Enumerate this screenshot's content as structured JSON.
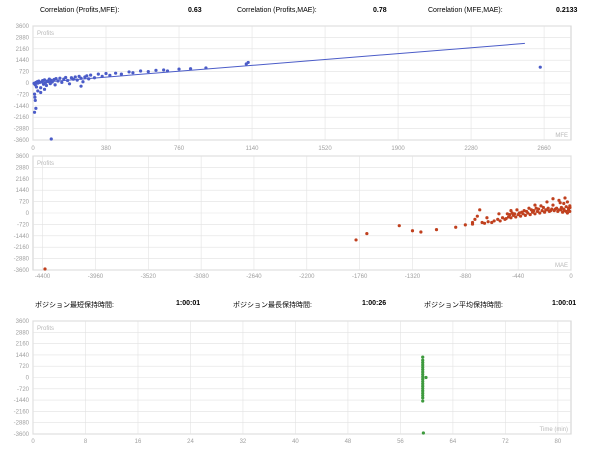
{
  "stats_top": [
    {
      "label": "Correlation (Profits,MFE):",
      "value": "0.63"
    },
    {
      "label": "Correlation (Profits,MAE):",
      "value": "0.78"
    },
    {
      "label": "Correlation (MFE,MAE):",
      "value": "0.2133"
    }
  ],
  "stats_mid": [
    {
      "label": "ポジション最短保持時間:",
      "value": "1:00:01"
    },
    {
      "label": "ポジション最長保持時間:",
      "value": "1:00:26"
    },
    {
      "label": "ポジション平均保持時間:",
      "value": "1:00:01"
    }
  ],
  "colors": {
    "mfe": "#4b5cc8",
    "mae": "#c0401e",
    "time": "#3e9a3e",
    "grid": "#e2e2e2",
    "frame": "#cfcfcf",
    "tick": "#a0a0a0"
  },
  "chart_data": [
    {
      "type": "scatter",
      "xlabel": "MFE",
      "ylabel": "Profits",
      "xticks": [
        "0",
        "380",
        "760",
        "1140",
        "1520",
        "1900",
        "2280",
        "2660"
      ],
      "yticks": [
        "3600",
        "2880",
        "2160",
        "1440",
        "720",
        "0",
        "-720",
        "-1440",
        "-2160",
        "-2880",
        "-3600"
      ],
      "xlim": [
        0,
        2800
      ],
      "ylim": [
        -3600,
        3600
      ],
      "trendline": {
        "x": [
          0,
          2560
        ],
        "y": [
          0,
          2500
        ]
      },
      "points": [
        [
          5,
          -20
        ],
        [
          10,
          -60
        ],
        [
          12,
          -120
        ],
        [
          15,
          30
        ],
        [
          18,
          -250
        ],
        [
          22,
          80
        ],
        [
          25,
          -10
        ],
        [
          30,
          120
        ],
        [
          35,
          40
        ],
        [
          40,
          -300
        ],
        [
          45,
          60
        ],
        [
          50,
          150
        ],
        [
          55,
          -80
        ],
        [
          60,
          200
        ],
        [
          65,
          20
        ],
        [
          70,
          -160
        ],
        [
          75,
          130
        ],
        [
          80,
          90
        ],
        [
          85,
          250
        ],
        [
          90,
          -40
        ],
        [
          95,
          170
        ],
        [
          100,
          60
        ],
        [
          110,
          220
        ],
        [
          115,
          -120
        ],
        [
          120,
          280
        ],
        [
          130,
          130
        ],
        [
          140,
          300
        ],
        [
          150,
          40
        ],
        [
          160,
          250
        ],
        [
          170,
          350
        ],
        [
          180,
          160
        ],
        [
          190,
          -50
        ],
        [
          200,
          330
        ],
        [
          210,
          240
        ],
        [
          220,
          380
        ],
        [
          230,
          180
        ],
        [
          240,
          420
        ],
        [
          250,
          300
        ],
        [
          260,
          80
        ],
        [
          270,
          380
        ],
        [
          280,
          450
        ],
        [
          290,
          260
        ],
        [
          300,
          500
        ],
        [
          320,
          330
        ],
        [
          340,
          560
        ],
        [
          360,
          420
        ],
        [
          380,
          600
        ],
        [
          400,
          480
        ],
        [
          430,
          620
        ],
        [
          460,
          560
        ],
        [
          500,
          700
        ],
        [
          520,
          650
        ],
        [
          560,
          760
        ],
        [
          600,
          720
        ],
        [
          640,
          800
        ],
        [
          680,
          820
        ],
        [
          700,
          760
        ],
        [
          760,
          880
        ],
        [
          820,
          900
        ],
        [
          900,
          950
        ],
        [
          1110,
          1200
        ],
        [
          1120,
          1300
        ],
        [
          8,
          -700
        ],
        [
          10,
          -900
        ],
        [
          12,
          -1100
        ],
        [
          15,
          -1600
        ],
        [
          8,
          -1850
        ],
        [
          25,
          -500
        ],
        [
          40,
          -600
        ],
        [
          60,
          -400
        ],
        [
          95,
          -3800
        ],
        [
          250,
          -200
        ],
        [
          2640,
          1000
        ]
      ]
    },
    {
      "type": "scatter",
      "xlabel": "MAE",
      "ylabel": "Profits",
      "xticks": [
        "-4400",
        "-3960",
        "-3520",
        "-3080",
        "-2640",
        "-2200",
        "-1760",
        "-1320",
        "-880",
        "-440",
        "0"
      ],
      "yticks": [
        "3600",
        "2880",
        "2160",
        "1440",
        "720",
        "0",
        "-720",
        "-1440",
        "-2160",
        "-2880",
        "-3600"
      ],
      "xlim": [
        -4480,
        0
      ],
      "ylim": [
        -3600,
        3600
      ],
      "points": [
        [
          -4380,
          -3900
        ],
        [
          -1790,
          -1700
        ],
        [
          -1700,
          -1300
        ],
        [
          -1430,
          -800
        ],
        [
          -1320,
          -1120
        ],
        [
          -1250,
          -1200
        ],
        [
          -1120,
          -1050
        ],
        [
          -960,
          -900
        ],
        [
          -880,
          -750
        ],
        [
          -820,
          -600
        ],
        [
          -800,
          -400
        ],
        [
          -780,
          -200
        ],
        [
          -760,
          200
        ],
        [
          -740,
          -600
        ],
        [
          -720,
          -650
        ],
        [
          -690,
          -550
        ],
        [
          -660,
          -600
        ],
        [
          -640,
          -500
        ],
        [
          -610,
          -400
        ],
        [
          -590,
          -500
        ],
        [
          -570,
          -300
        ],
        [
          -550,
          -400
        ],
        [
          -540,
          -350
        ],
        [
          -520,
          -250
        ],
        [
          -500,
          -300
        ],
        [
          -480,
          -150
        ],
        [
          -460,
          -250
        ],
        [
          -440,
          -100
        ],
        [
          -420,
          -200
        ],
        [
          -400,
          -50
        ],
        [
          -380,
          -150
        ],
        [
          -360,
          0
        ],
        [
          -340,
          -100
        ],
        [
          -320,
          50
        ],
        [
          -300,
          -50
        ],
        [
          -280,
          100
        ],
        [
          -260,
          0
        ],
        [
          -240,
          150
        ],
        [
          -220,
          50
        ],
        [
          -200,
          200
        ],
        [
          -180,
          100
        ],
        [
          -160,
          250
        ],
        [
          -140,
          150
        ],
        [
          -120,
          300
        ],
        [
          -100,
          200
        ],
        [
          -80,
          350
        ],
        [
          -60,
          250
        ],
        [
          -40,
          400
        ],
        [
          -20,
          300
        ],
        [
          -10,
          450
        ],
        [
          -5,
          350
        ],
        [
          -300,
          500
        ],
        [
          -200,
          700
        ],
        [
          -150,
          900
        ],
        [
          -100,
          800
        ],
        [
          -50,
          950
        ],
        [
          -60,
          600
        ],
        [
          -350,
          300
        ],
        [
          -250,
          450
        ],
        [
          -150,
          500
        ],
        [
          -90,
          650
        ],
        [
          -30,
          700
        ],
        [
          -450,
          200
        ],
        [
          -500,
          150
        ],
        [
          -600,
          -50
        ],
        [
          -700,
          -300
        ],
        [
          -820,
          -700
        ],
        [
          -10,
          100
        ],
        [
          -20,
          200
        ],
        [
          -30,
          0
        ],
        [
          -40,
          100
        ],
        [
          -55,
          150
        ],
        [
          -70,
          50
        ],
        [
          -85,
          200
        ],
        [
          -110,
          100
        ],
        [
          -130,
          250
        ],
        [
          -170,
          150
        ],
        [
          -190,
          300
        ],
        [
          -210,
          200
        ],
        [
          -230,
          350
        ],
        [
          -270,
          250
        ],
        [
          -290,
          300
        ],
        [
          -310,
          150
        ],
        [
          -330,
          200
        ],
        [
          -370,
          100
        ],
        [
          -390,
          150
        ],
        [
          -410,
          50
        ],
        [
          -430,
          0
        ],
        [
          -470,
          -50
        ],
        [
          -490,
          0
        ],
        [
          -510,
          -100
        ],
        [
          -530,
          -50
        ]
      ]
    },
    {
      "type": "scatter",
      "xlabel": "Time (min)",
      "ylabel": "Profits",
      "xticks": [
        "0",
        "8",
        "16",
        "24",
        "32",
        "40",
        "48",
        "56",
        "64",
        "72",
        "80"
      ],
      "yticks": [
        "3600",
        "2880",
        "2160",
        "1440",
        "720",
        "0",
        "-720",
        "-1440",
        "-2160",
        "-2880",
        "-3600"
      ],
      "xlim": [
        0,
        82
      ],
      "ylim": [
        -3600,
        3600
      ],
      "points": [
        [
          59.4,
          1300
        ],
        [
          59.4,
          1100
        ],
        [
          59.4,
          950
        ],
        [
          59.4,
          800
        ],
        [
          59.4,
          650
        ],
        [
          59.4,
          500
        ],
        [
          59.4,
          350
        ],
        [
          59.4,
          200
        ],
        [
          59.4,
          50
        ],
        [
          59.4,
          -100
        ],
        [
          59.4,
          -250
        ],
        [
          59.4,
          -400
        ],
        [
          59.4,
          -550
        ],
        [
          59.4,
          -700
        ],
        [
          59.4,
          -850
        ],
        [
          59.4,
          -1000
        ],
        [
          59.4,
          -1150
        ],
        [
          59.4,
          -1300
        ],
        [
          59.4,
          -1500
        ],
        [
          59.9,
          0
        ],
        [
          59.5,
          -3800
        ]
      ]
    }
  ]
}
